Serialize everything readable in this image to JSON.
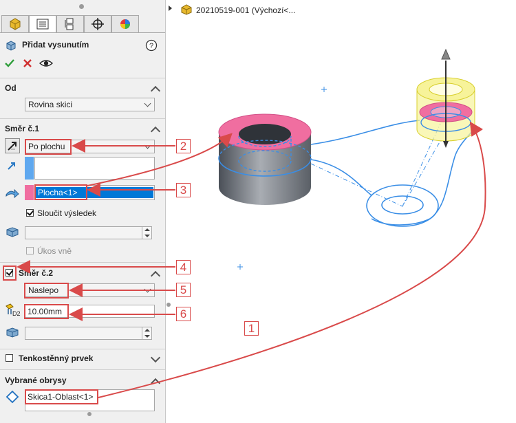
{
  "tree": {
    "part_name": "20210519-001  (Výchozí<..."
  },
  "tabs": [
    "feature-manager",
    "property-manager",
    "configuration-manager",
    "dim-xpert",
    "appearance"
  ],
  "feature": {
    "title": "Přidat vysunutím"
  },
  "from": {
    "header": "Od",
    "value": "Rovina skici"
  },
  "dir1": {
    "header": "Směr č.1",
    "end_condition": "Po plochu",
    "face": "Plocha<1>",
    "merge_label": "Sloučit výsledek",
    "draft_label": "Úkos vně"
  },
  "dir2": {
    "header": "Směr č.2",
    "end_condition": "Naslepo",
    "depth": "10.00mm"
  },
  "thin": {
    "header": "Tenkostěnný prvek"
  },
  "contours": {
    "header": "Vybrané obrysy",
    "item": "Skica1-Oblast<1>"
  },
  "callouts": [
    "1",
    "2",
    "3",
    "4",
    "5",
    "6"
  ],
  "colors": {
    "accent": "#d94a4a",
    "selection": "#0078d7",
    "face": "#f06ea0",
    "sketch": "#3a8ee6"
  }
}
